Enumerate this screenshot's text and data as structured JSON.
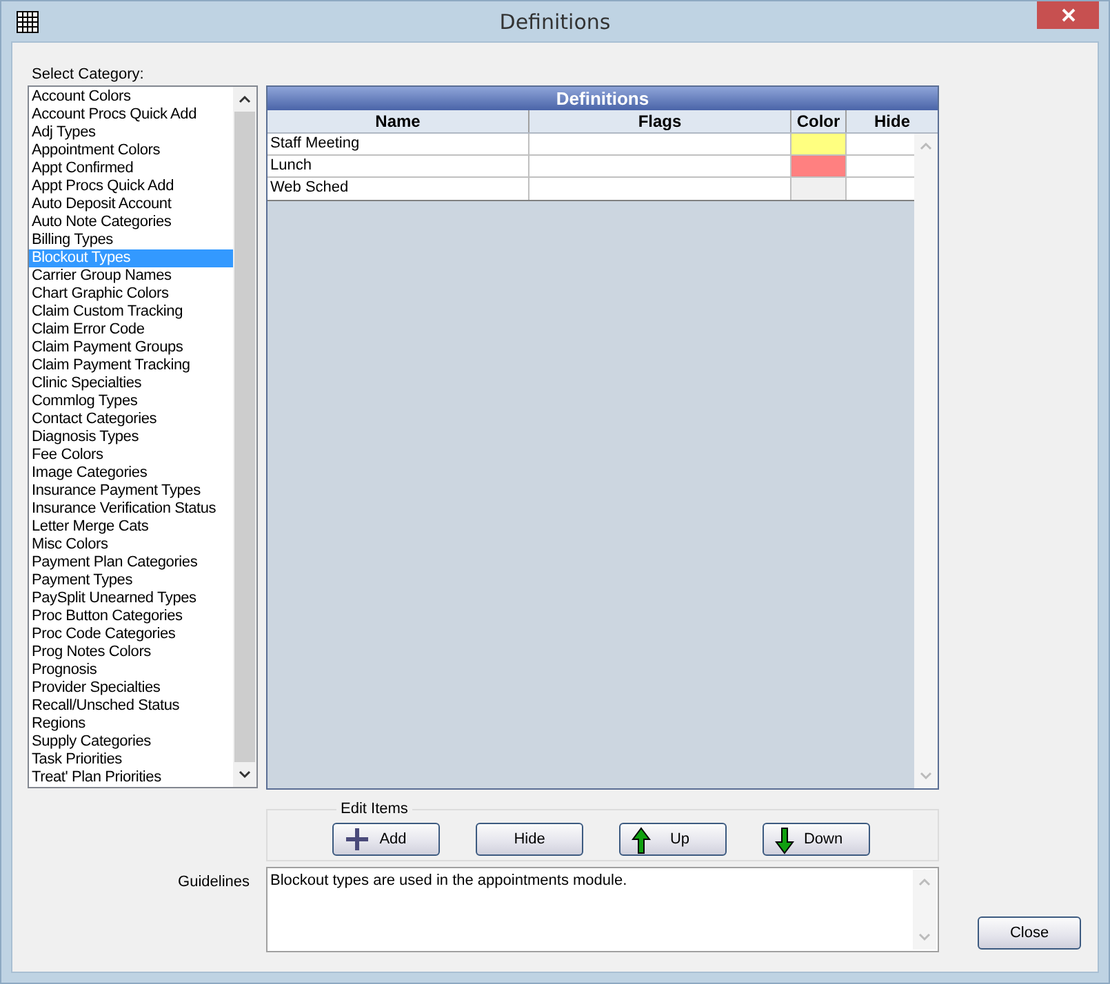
{
  "window": {
    "title": "Definitions"
  },
  "category_label": "Select Category:",
  "categories": [
    {
      "label": "Account Colors",
      "selected": false
    },
    {
      "label": "Account Procs Quick Add",
      "selected": false
    },
    {
      "label": "Adj Types",
      "selected": false
    },
    {
      "label": "Appointment Colors",
      "selected": false
    },
    {
      "label": "Appt Confirmed",
      "selected": false
    },
    {
      "label": "Appt Procs Quick Add",
      "selected": false
    },
    {
      "label": "Auto Deposit Account",
      "selected": false
    },
    {
      "label": "Auto Note Categories",
      "selected": false
    },
    {
      "label": "Billing Types",
      "selected": false
    },
    {
      "label": "Blockout Types",
      "selected": true
    },
    {
      "label": "Carrier Group Names",
      "selected": false
    },
    {
      "label": "Chart Graphic Colors",
      "selected": false
    },
    {
      "label": "Claim Custom Tracking",
      "selected": false
    },
    {
      "label": "Claim Error Code",
      "selected": false
    },
    {
      "label": "Claim Payment Groups",
      "selected": false
    },
    {
      "label": "Claim Payment Tracking",
      "selected": false
    },
    {
      "label": "Clinic Specialties",
      "selected": false
    },
    {
      "label": "Commlog Types",
      "selected": false
    },
    {
      "label": "Contact Categories",
      "selected": false
    },
    {
      "label": "Diagnosis Types",
      "selected": false
    },
    {
      "label": "Fee Colors",
      "selected": false
    },
    {
      "label": "Image Categories",
      "selected": false
    },
    {
      "label": "Insurance Payment Types",
      "selected": false
    },
    {
      "label": "Insurance Verification Status",
      "selected": false
    },
    {
      "label": "Letter Merge Cats",
      "selected": false
    },
    {
      "label": "Misc Colors",
      "selected": false
    },
    {
      "label": "Payment Plan Categories",
      "selected": false
    },
    {
      "label": "Payment Types",
      "selected": false
    },
    {
      "label": "PaySplit Unearned Types",
      "selected": false
    },
    {
      "label": "Proc Button Categories",
      "selected": false
    },
    {
      "label": "Proc Code Categories",
      "selected": false
    },
    {
      "label": "Prog Notes Colors",
      "selected": false
    },
    {
      "label": "Prognosis",
      "selected": false
    },
    {
      "label": "Provider Specialties",
      "selected": false
    },
    {
      "label": "Recall/Unsched Status",
      "selected": false
    },
    {
      "label": "Regions",
      "selected": false
    },
    {
      "label": "Supply Categories",
      "selected": false
    },
    {
      "label": "Task Priorities",
      "selected": false
    },
    {
      "label": "Treat' Plan Priorities",
      "selected": false
    }
  ],
  "table": {
    "title": "Definitions",
    "columns": [
      "Name",
      "Flags",
      "Color",
      "Hide"
    ],
    "rows": [
      {
        "name": "Staff Meeting",
        "color": "#ffff80"
      },
      {
        "name": "Lunch",
        "color": "#ff8080"
      },
      {
        "name": "Web Sched",
        "color": "#f0f0f0"
      }
    ]
  },
  "edit_items": {
    "label": "Edit Items",
    "buttons": [
      {
        "kind": "add",
        "label": "Add"
      },
      {
        "kind": "hide",
        "label": "Hide"
      },
      {
        "kind": "up",
        "label": "Up"
      },
      {
        "kind": "down",
        "label": "Down"
      }
    ]
  },
  "guidelines": {
    "label": "Guidelines",
    "text": "Blockout types are used in the appointments module."
  },
  "close_button": "Close"
}
